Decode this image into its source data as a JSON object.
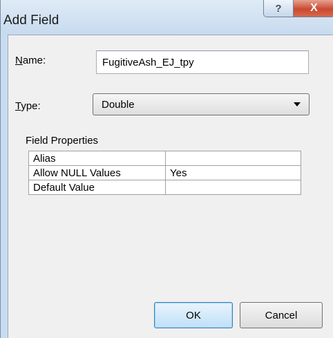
{
  "window": {
    "title": "Add Field",
    "help_label": "?",
    "close_label": "X"
  },
  "form": {
    "name_label_mnemonic": "N",
    "name_label_rest": "ame:",
    "name_value": "FugitiveAsh_EJ_tpy",
    "type_label_mnemonic": "T",
    "type_label_rest": "ype:",
    "type_value": "Double"
  },
  "field_properties": {
    "title": "Field Properties",
    "rows": [
      {
        "property": "Alias",
        "value": ""
      },
      {
        "property": "Allow NULL Values",
        "value": "Yes"
      },
      {
        "property": "Default Value",
        "value": ""
      }
    ]
  },
  "buttons": {
    "ok": "OK",
    "cancel": "Cancel"
  }
}
